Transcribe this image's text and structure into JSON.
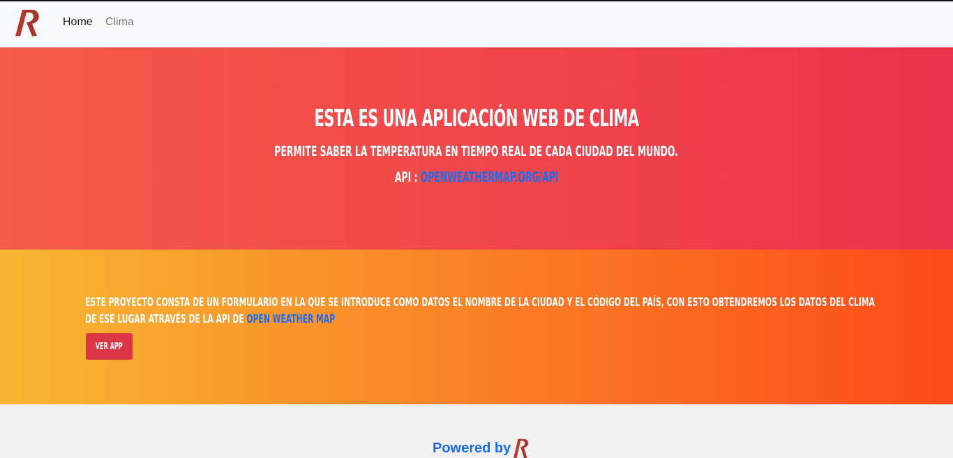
{
  "navbar": {
    "logo_icon": "rp-logo-icon",
    "links": [
      {
        "label": "Home"
      },
      {
        "label": "Clima"
      }
    ]
  },
  "hero": {
    "title": "Esta es una aplicación web de clima",
    "subtitle": "Permite saber la temperatura en tiempo real de cada ciudad del mundo.",
    "api_prefix": "API : ",
    "api_link": "openweathermap.org/api"
  },
  "project": {
    "description": "Este proyecto consta de un formulario en la que se introduce como datos el nombre de la ciudad y el código del país, con esto obtendremos los datos del clima de ese lugar através de la API de ",
    "link_text": "Open Weather Map",
    "button_label": "Ver App"
  },
  "footer": {
    "powered_label": "Powered by",
    "logo_icon": "rp-logo-icon"
  },
  "colors": {
    "hero_gradient": [
      "#f45b48",
      "#ec334d"
    ],
    "project_gradient": [
      "#f7b733",
      "#fc4a1a"
    ],
    "link": "#1c6bf3",
    "button": "#dc3545",
    "logo": "#a8352c"
  }
}
